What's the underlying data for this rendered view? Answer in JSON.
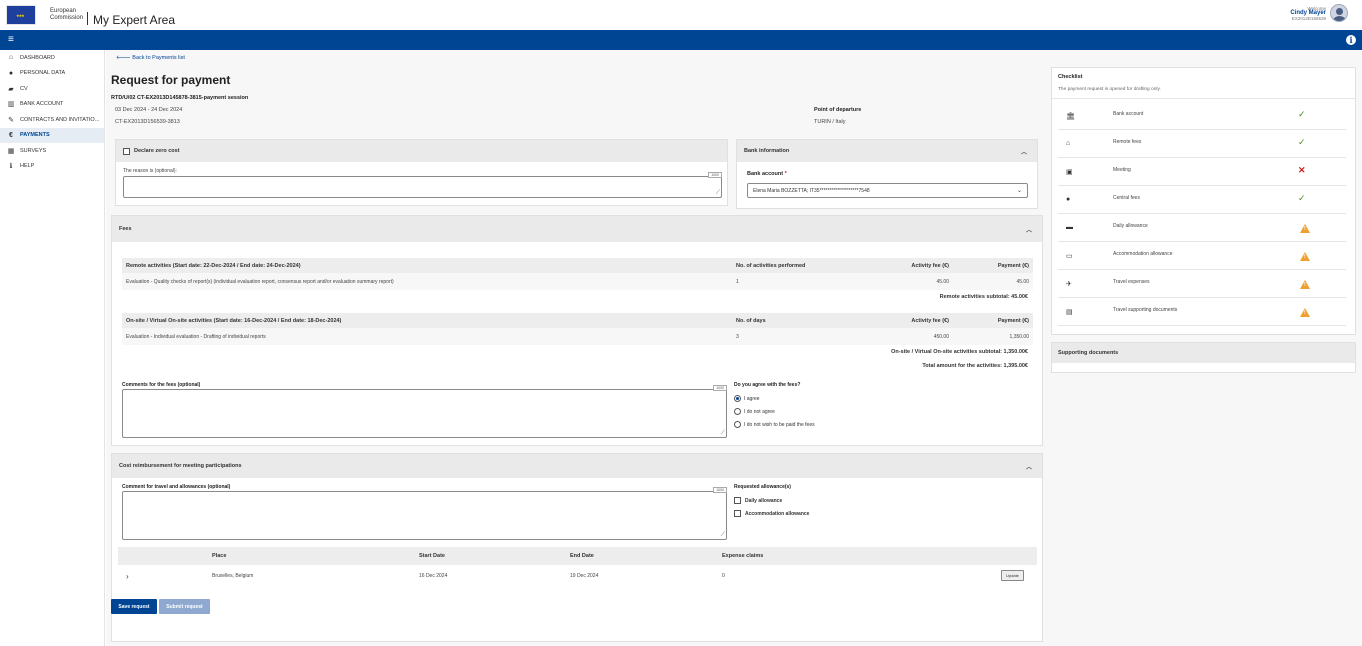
{
  "header": {
    "org_line1": "European",
    "org_line2": "Commission",
    "app_title": "My Expert Area",
    "welcome": "Welcome",
    "user_name": "Cindy Mayer",
    "user_id": "EX2013D156539"
  },
  "sidebar": {
    "items": [
      {
        "label": "Dashboard",
        "icon": "home-icon"
      },
      {
        "label": "Personal data",
        "icon": "user-icon"
      },
      {
        "label": "CV",
        "icon": "graduation-cap-icon"
      },
      {
        "label": "Bank account",
        "icon": "bank-icon"
      },
      {
        "label": "Contracts and invitatio...",
        "icon": "edit-icon"
      },
      {
        "label": "Payments",
        "icon": "euro-icon",
        "active": true
      },
      {
        "label": "Surveys",
        "icon": "table-icon"
      },
      {
        "label": "Help",
        "icon": "info-icon"
      }
    ]
  },
  "main": {
    "back_link": "Back to Payments list",
    "title": "Request for payment",
    "session": "RTD/U/02 CT-EX2013D145878-3815-payment session",
    "dates": "03 Dec 2024 - 24 Dec 2024",
    "contract": "CT-EX2013D156539-3813",
    "point_of_departure_label": "Point of departure",
    "point_of_departure_value": "TURIN / Italy"
  },
  "zero_cost": {
    "label": "Declare zero cost",
    "reason_label": "The reason is (optional):",
    "counter": "1000"
  },
  "bank": {
    "title": "Bank information",
    "account_label": "Bank account",
    "required_mark": "*",
    "account_value": "Elena Maria BOZZETTA; IT35********************7548"
  },
  "fees": {
    "title": "Fees",
    "remote": {
      "header": "Remote activities (Start date: 22-Dec-2024 / End date: 24-Dec-2024)",
      "col_count": "No. of activities performed",
      "col_fee": "Activity fee (€)",
      "col_payment": "Payment (€)",
      "row": {
        "desc": "Evaluation - Quality checks of report(s) (individual evaluation report, consensus report and/or evaluation summary report)",
        "count": "1",
        "fee": "45.00",
        "payment": "45.00"
      },
      "subtotal": "Remote activities subtotal: 45.00€"
    },
    "onsite": {
      "header": "On-site / Virtual On-site activities (Start date: 16-Dec-2024 / End date: 18-Dec-2024)",
      "col_count": "No. of days",
      "col_fee": "Activity fee (€)",
      "col_payment": "Payment (€)",
      "row": {
        "desc": "Evaluation - Individual evaluation - Drafting of individual reports",
        "count": "3",
        "fee": "450.00",
        "payment": "1,350.00"
      },
      "subtotal": "On-site / Virtual On-site activities subtotal: 1,350.00€"
    },
    "total": "Total amount for the activities: 1,395.00€",
    "comments_label": "Comments for the fees (optional)",
    "counter": "1000",
    "agree_question": "Do you agree with the fees?",
    "options": [
      "I agree",
      "I do not agree",
      "I do not wish to be paid the fees"
    ]
  },
  "meeting": {
    "title": "Cost reimbursement for meeting participations",
    "comment_label": "Comment for travel and allowances (optional)",
    "counter": "1000",
    "allowances_label": "Requested allowance(s)",
    "allowances": [
      "Daily allowance",
      "Accommodation allowance"
    ],
    "columns": [
      "Place",
      "Start Date",
      "End Date",
      "Expense claims"
    ],
    "row": {
      "place": "Bruxelles, Belgium",
      "start": "16 Dec 2024",
      "end": "19 Dec 2024",
      "claims": "0",
      "action": "Update"
    }
  },
  "actions": {
    "save": "Save request",
    "submit": "Submit request"
  },
  "checklist": {
    "title": "Checklist",
    "subtitle": "The payment request is opened for drafting only.",
    "items": [
      {
        "label": "Bank account",
        "icon": "bank-icon",
        "status": "ok"
      },
      {
        "label": "Remote fees",
        "icon": "home-icon",
        "status": "ok"
      },
      {
        "label": "Meeting",
        "icon": "calendar-icon",
        "status": "error"
      },
      {
        "label": "Central fees",
        "icon": "euro-circle-icon",
        "status": "ok"
      },
      {
        "label": "Daily allowance",
        "icon": "briefcase-icon",
        "status": "warning"
      },
      {
        "label": "Accommodation allowance",
        "icon": "bed-icon",
        "status": "warning"
      },
      {
        "label": "Travel expenses",
        "icon": "plane-icon",
        "status": "warning"
      },
      {
        "label": "Travel supporting documents",
        "icon": "document-icon",
        "status": "warning"
      }
    ]
  },
  "supporting_documents": {
    "title": "Supporting documents"
  }
}
